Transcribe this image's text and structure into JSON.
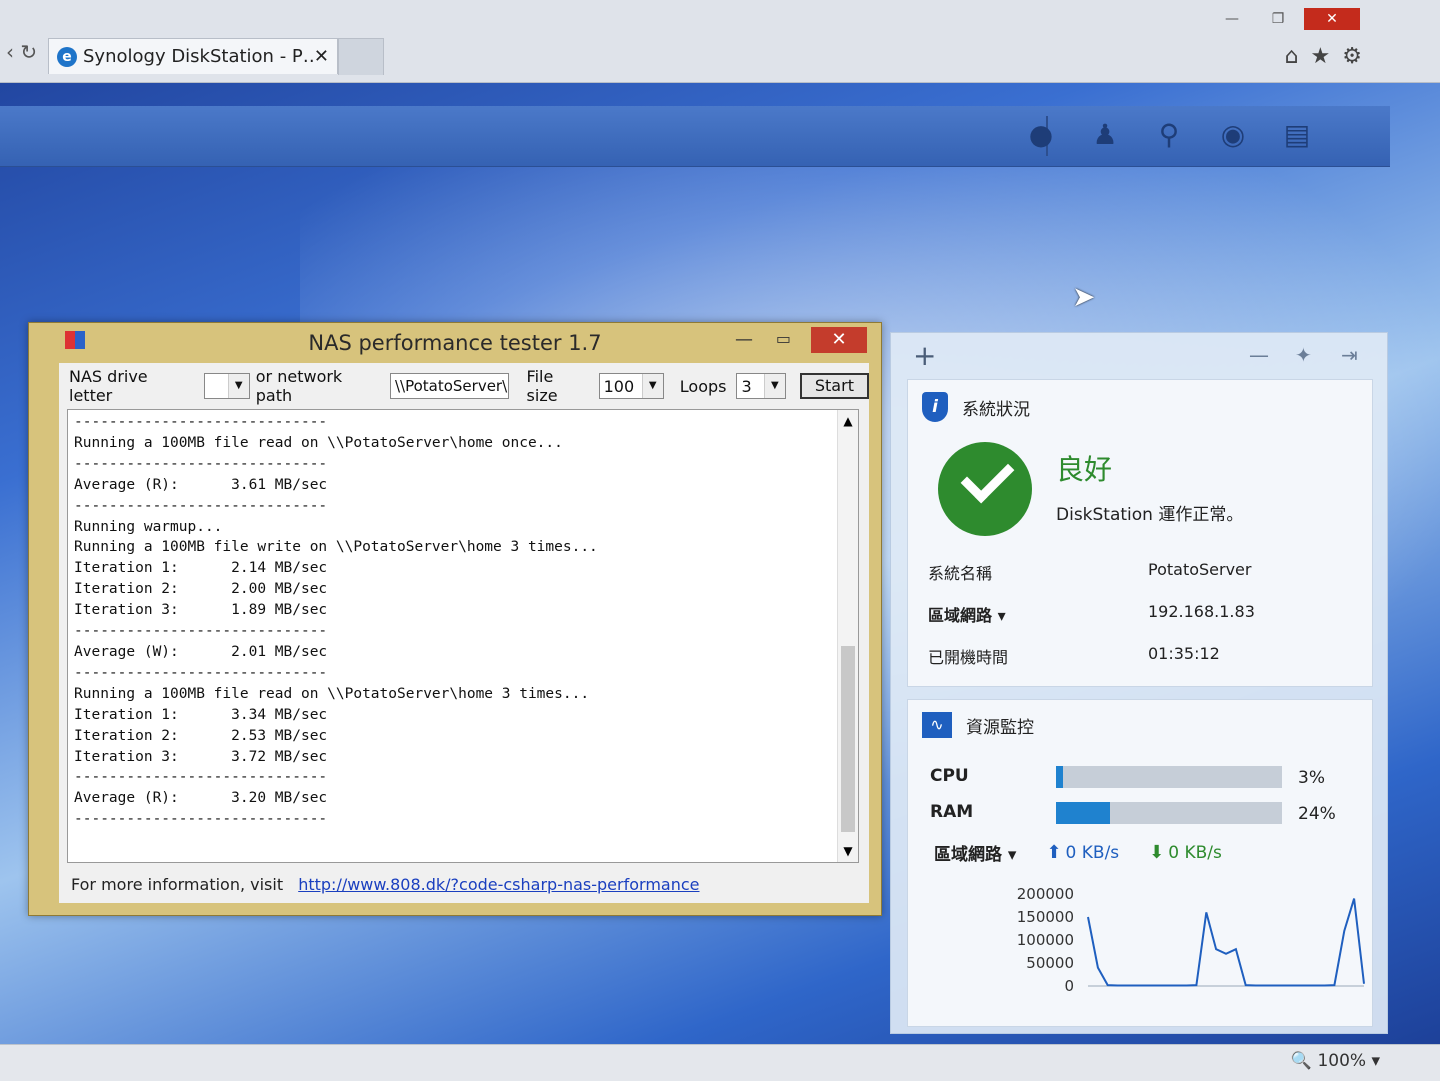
{
  "browser": {
    "tab_title": "Synology DiskStation - P…",
    "tab_close": "✕",
    "window_min": "—",
    "window_max": "❐",
    "window_close": "✕",
    "zoom": "100%"
  },
  "nas_tester": {
    "title": "NAS performance tester 1.7",
    "drive_label": "NAS drive letter",
    "drive_value": "",
    "path_label": "or network path",
    "path_value": "\\\\PotatoServer\\h",
    "filesize_label": "File size",
    "filesize_value": "100",
    "loops_label": "Loops",
    "loops_value": "3",
    "start_label": "Start",
    "output": "-----------------------------\nRunning a 100MB file read on \\\\PotatoServer\\home once...\n-----------------------------\nAverage (R):      3.61 MB/sec\n-----------------------------\nRunning warmup...\nRunning a 100MB file write on \\\\PotatoServer\\home 3 times...\nIteration 1:      2.14 MB/sec\nIteration 2:      2.00 MB/sec\nIteration 3:      1.89 MB/sec\n-----------------------------\nAverage (W):      2.01 MB/sec\n-----------------------------\nRunning a 100MB file read on \\\\PotatoServer\\home 3 times...\nIteration 1:      3.34 MB/sec\nIteration 2:      2.53 MB/sec\nIteration 3:      3.72 MB/sec\n-----------------------------\nAverage (R):      3.20 MB/sec\n-----------------------------",
    "info_text": "For more information, visit",
    "info_link": "http://www.808.dk/?code-csharp-nas-performance"
  },
  "widgets": {
    "add_label": "+",
    "system_status": {
      "title": "系統狀況",
      "status": "良好",
      "message": "DiskStation 運作正常。",
      "rows": [
        {
          "key": "系統名稱",
          "value": "PotatoServer"
        },
        {
          "key": "區域網路 ▾",
          "value": "192.168.1.83"
        },
        {
          "key": "已開機時間",
          "value": "01:35:12"
        }
      ]
    },
    "resource_monitor": {
      "title": "資源監控",
      "cpu_label": "CPU",
      "cpu_pct": 3,
      "cpu_text": "3%",
      "ram_label": "RAM",
      "ram_pct": 24,
      "ram_text": "24%",
      "net_label": "區域網路 ▾",
      "upload": "0 KB/s",
      "download": "0 KB/s",
      "bar_color": "#1f82cf"
    }
  },
  "chart_data": {
    "type": "line",
    "title": "",
    "xlabel": "",
    "ylabel": "",
    "ylim": [
      0,
      200000
    ],
    "yticks": [
      "200000",
      "150000",
      "100000",
      "50000",
      "0"
    ],
    "series": [
      {
        "values": [
          150000,
          40000,
          2000,
          1000,
          1000,
          1000,
          1000,
          1000,
          1000,
          1000,
          1000,
          2000,
          160000,
          80000,
          70000,
          80000,
          2000,
          1000,
          1000,
          1000,
          1000,
          1000,
          1000,
          1000,
          1000,
          2000,
          120000,
          190000,
          5000
        ]
      }
    ],
    "color": "#1f5fbf"
  }
}
